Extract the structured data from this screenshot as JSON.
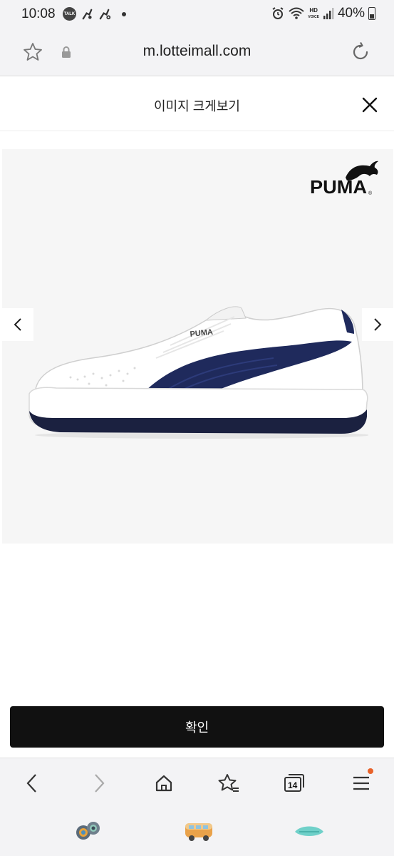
{
  "status_bar": {
    "time": "10:08",
    "talk_badge": "TALK",
    "hd_label": "HD",
    "voice_label": "VOICE",
    "battery": "40%"
  },
  "browser": {
    "url": "m.lotteimall.com"
  },
  "modal": {
    "title": "이미지 크게보기",
    "brand_logo_text": "PUMA",
    "brand_logo_mark": "®",
    "confirm_label": "확인"
  },
  "toolbar": {
    "tabs_count": "14",
    "notification_color": "#e8622a"
  },
  "colors": {
    "confirm_bg": "#111111",
    "shoe_accent": "#1f2a5c"
  }
}
